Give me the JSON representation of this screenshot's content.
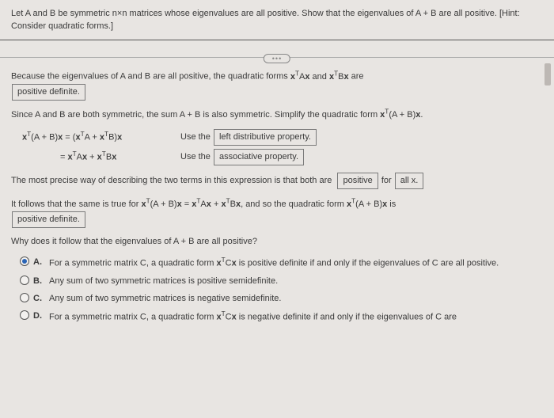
{
  "question": {
    "text": "Let A and B be symmetric n×n matrices whose eigenvalues are all positive. Show that the eigenvalues of A + B are all positive. [Hint: Consider quadratic forms.]"
  },
  "ellipsis": "•••",
  "p1": {
    "pre": "Because the eigenvalues of A and B are all positive, the quadratic forms ",
    "math1_html": "<b>x</b><sup>T</sup>A<b>x</b> and <b>x</b><sup>T</sup>B<b>x</b>",
    "post": " are",
    "ans": "positive definite."
  },
  "p2": {
    "text_html": "Since A and B are both symmetric, the sum A + B is also symmetric. Simplify the quadratic form <b>x</b><sup>T</sup>(A + B)<b>x</b>."
  },
  "eq1": {
    "lhs_html": "<b>x</b><sup>T</sup>(A + B)<b>x</b> = (<b>x</b><sup>T</sup>A + <b>x</b><sup>T</sup>B)<b>x</b>",
    "useword": "Use the",
    "ans": "left distributive property."
  },
  "eq2": {
    "lhs_html": "= <b>x</b><sup>T</sup>A<b>x</b> + <b>x</b><sup>T</sup>B<b>x</b>",
    "useword": "Use the",
    "ans": "associative property."
  },
  "p3": {
    "pre": "The most precise way of describing the two terms in this expression is that both are",
    "ans1": "positive",
    "mid": "for",
    "ans2": "all x."
  },
  "p4": {
    "pre_html": "It follows that the same is true for <b>x</b><sup>T</sup>(A + B)<b>x</b> = <b>x</b><sup>T</sup>A<b>x</b> + <b>x</b><sup>T</sup>B<b>x</b>, and so the quadratic form <b>x</b><sup>T</sup>(A + B)<b>x</b> is",
    "ans": "positive definite."
  },
  "p5": "Why does it follow that the eigenvalues of A + B are all positive?",
  "choices": [
    {
      "letter": "A.",
      "selected": true,
      "text_html": "For a symmetric matrix C, a quadratic form <b>x</b><sup>T</sup>C<b>x</b> is positive definite if and only if the eigenvalues of C are all positive."
    },
    {
      "letter": "B.",
      "selected": false,
      "text_html": "Any sum of two symmetric matrices is positive semidefinite."
    },
    {
      "letter": "C.",
      "selected": false,
      "text_html": "Any sum of two symmetric matrices is negative semidefinite."
    },
    {
      "letter": "D.",
      "selected": false,
      "text_html": "For a symmetric matrix C, a quadratic form <b>x</b><sup>T</sup>C<b>x</b> is negative definite if and only if the eigenvalues of C are"
    }
  ]
}
